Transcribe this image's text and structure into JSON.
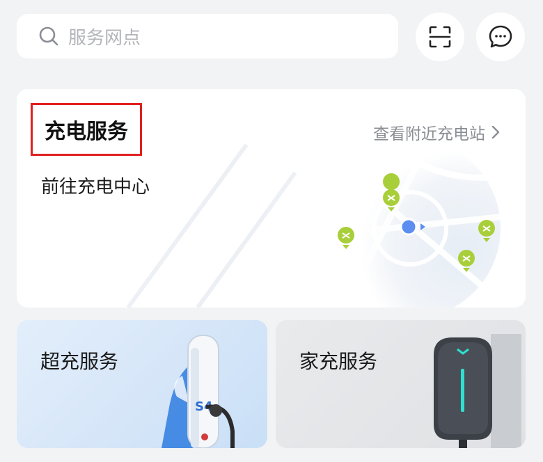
{
  "search": {
    "placeholder": "服务网点",
    "icon": "search-icon"
  },
  "header_actions": [
    {
      "icon": "scan-icon"
    },
    {
      "icon": "message-icon"
    }
  ],
  "charge_card": {
    "title": "充电服务",
    "nearby_link": "查看附近充电站",
    "subtitle": "前往充电中心",
    "highlight_color": "#e02020"
  },
  "tiles": [
    {
      "label": "超充服务",
      "illustration": "supercharger-illustration"
    },
    {
      "label": "家充服务",
      "illustration": "home-charger-illustration"
    }
  ],
  "colors": {
    "background": "#f2f3f5",
    "card": "#ffffff",
    "pin": "#a8cf3a",
    "location_dot": "#5b8ef0",
    "accent_teal": "#2ee0d0"
  }
}
